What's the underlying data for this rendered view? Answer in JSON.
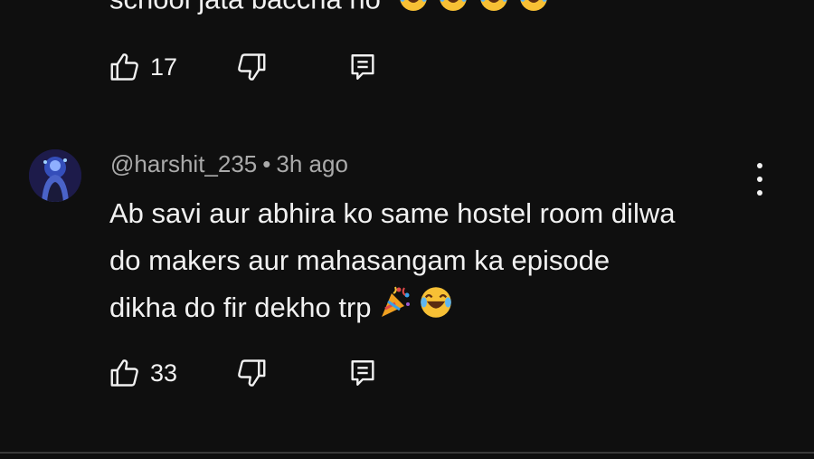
{
  "previous_comment": {
    "text_fragment": "school jata baccha ho",
    "emoji_icon": "laughing-tears-emoji",
    "emoji_count": 4,
    "like_count": "17"
  },
  "comment": {
    "handle": "@harshit_235",
    "separator": "•",
    "time": "3h ago",
    "lines": [
      "Ab savi aur abhira ko same hostel room dilwa",
      "do makers aur mahasangam ka episode",
      "dikha do fir dekho trp"
    ],
    "trailing_emojis": [
      "party-popper-emoji",
      "laughing-tears-emoji"
    ],
    "like_count": "33"
  },
  "icons": {
    "like": "thumbs-up-icon",
    "dislike": "thumbs-down-icon",
    "reply": "reply-comment-icon",
    "menu": "more-vert-icon"
  },
  "colors": {
    "background": "#0f0f0f",
    "text": "#f1f1f1",
    "meta": "#aaaaaa"
  }
}
